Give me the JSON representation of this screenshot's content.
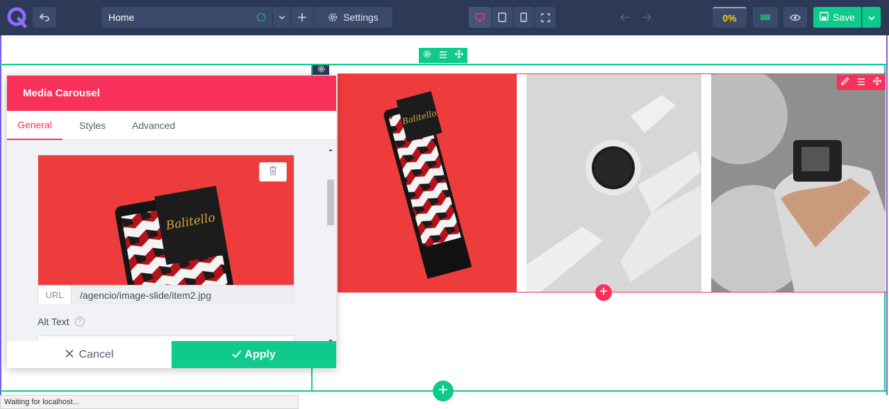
{
  "topbar": {
    "logo_icon": "q-logo-icon",
    "back_icon": "undo-icon",
    "page_select": {
      "value": "Home"
    },
    "add_page_icon": "plus-icon",
    "settings_label": "Settings",
    "devices": [
      "desktop-icon",
      "tablet-icon",
      "mobile-icon",
      "fullscreen-icon"
    ],
    "percent": "0%",
    "save_label": "Save"
  },
  "panel": {
    "title": "Media Carousel",
    "tabs": [
      {
        "label": "General",
        "active": true
      },
      {
        "label": "Styles",
        "active": false
      },
      {
        "label": "Advanced",
        "active": false
      }
    ],
    "url_label": "URL",
    "url_value": "/agencio/image-slide/item2.jpg",
    "alt_label": "Alt Text",
    "alt_help": "?",
    "cancel_label": "Cancel",
    "apply_label": "Apply"
  },
  "product": {
    "brand": "Balitello"
  },
  "status": "Waiting for localhost...",
  "colors": {
    "topbar": "#2c3a57",
    "accent_pink": "#f8315a",
    "accent_green": "#10c98c",
    "percent_yellow": "#f6d000"
  }
}
